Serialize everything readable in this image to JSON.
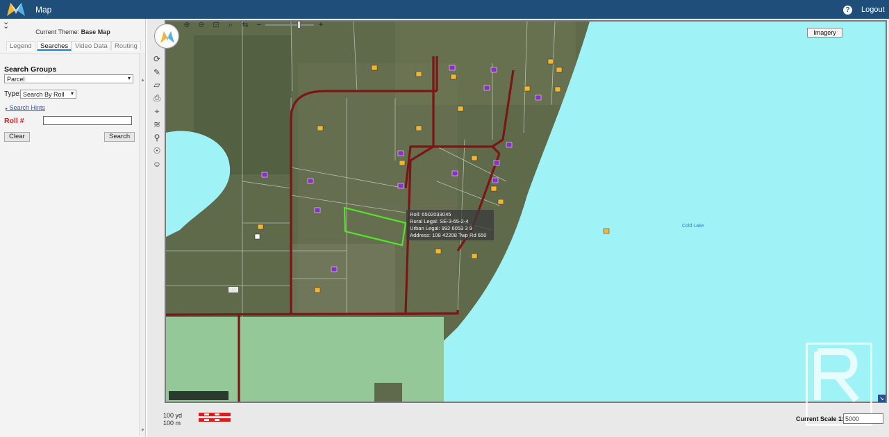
{
  "header": {
    "app_title": "Map",
    "logout_label": "Logout",
    "help_glyph": "?"
  },
  "left_panel": {
    "theme_prefix": "Current Theme:",
    "theme_name": "Base Map",
    "tabs": [
      "Legend",
      "Searches",
      "Video Data",
      "Routing"
    ],
    "active_tab": "Searches",
    "search_groups_label": "Search Groups",
    "search_group_value": "Parcel",
    "type_label": "Type:",
    "type_value": "Search By Roll",
    "hints_label": "Search Hints",
    "roll_label": "Roll #",
    "roll_value": "",
    "clear_label": "Clear",
    "search_label": "Search"
  },
  "map": {
    "imagery_label": "Imagery",
    "lake_label": "Cold Lake",
    "tooltip": {
      "roll": "Roll: 6502033045",
      "rural": "Rural Legal: SE-3-65-2-4",
      "urban": "Urban Legal: 992 6053 3 9",
      "address": "Address: 108 42208 Twp Rd 650"
    },
    "colors": {
      "water": "#9ff3f7",
      "road": "#7a1616",
      "selection": "#55e22a",
      "field": "#95c898",
      "forest": "#5e6a4a",
      "header": "#1f4e7a"
    },
    "marker_icons": [
      "home-icon-yellow",
      "home-icon-purple"
    ]
  },
  "status": {
    "scale_yd": "100 yd",
    "scale_m": "100 m",
    "current_scale_label": "Current Scale 1:",
    "current_scale_value": "5000"
  }
}
